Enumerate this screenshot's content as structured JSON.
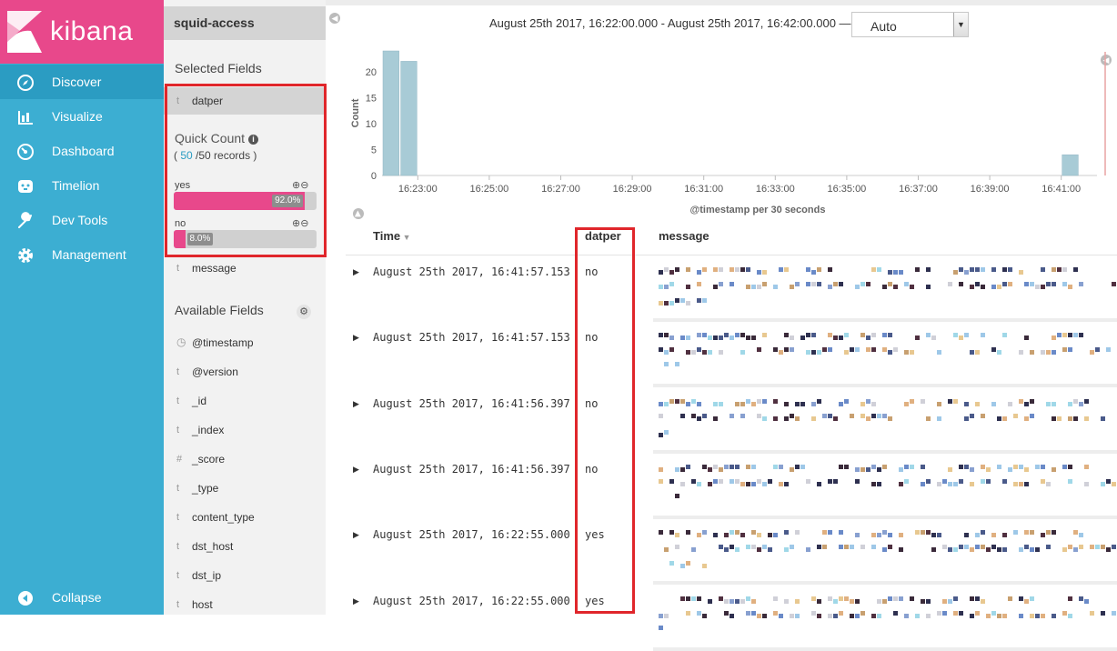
{
  "brand": {
    "name": "kibana",
    "logo_color": "#e8488b",
    "nav_color": "#3caed2"
  },
  "nav": {
    "items": [
      {
        "label": "Discover",
        "icon": "compass-icon",
        "active": true
      },
      {
        "label": "Visualize",
        "icon": "bar-chart-icon",
        "active": false
      },
      {
        "label": "Dashboard",
        "icon": "gauge-icon",
        "active": false
      },
      {
        "label": "Timelion",
        "icon": "timelion-icon",
        "active": false
      },
      {
        "label": "Dev Tools",
        "icon": "wrench-icon",
        "active": false
      },
      {
        "label": "Management",
        "icon": "gear-icon",
        "active": false
      }
    ],
    "collapse_label": "Collapse"
  },
  "sidebar": {
    "index_pattern": "squid-access",
    "selected_title": "Selected Fields",
    "selected_fields": [
      {
        "type": "t",
        "name": "datper"
      },
      {
        "type": "t",
        "name": "message"
      }
    ],
    "quick_count": {
      "title": "Quick Count",
      "records_prefix": "( ",
      "records_link": "50",
      "records_suffix": " /50 records )",
      "values": [
        {
          "label": "yes",
          "percent": 92.0,
          "percent_label": "92.0%"
        },
        {
          "label": "no",
          "percent": 8.0,
          "percent_label": "8.0%"
        }
      ]
    },
    "available_title": "Available Fields",
    "available_fields": [
      {
        "type": "clock",
        "name": "@timestamp"
      },
      {
        "type": "t",
        "name": "@version"
      },
      {
        "type": "t",
        "name": "_id"
      },
      {
        "type": "t",
        "name": "_index"
      },
      {
        "type": "#",
        "name": "_score"
      },
      {
        "type": "t",
        "name": "_type"
      },
      {
        "type": "t",
        "name": "content_type"
      },
      {
        "type": "t",
        "name": "dst_host"
      },
      {
        "type": "t",
        "name": "dst_ip"
      },
      {
        "type": "t",
        "name": "host"
      }
    ]
  },
  "header": {
    "time_range": "August 25th 2017, 16:22:00.000 - August 25th 2017, 16:42:00.000 —",
    "interval": "Auto"
  },
  "chart_data": {
    "type": "bar",
    "ylabel": "Count",
    "xlabel": "@timestamp per 30 seconds",
    "ylim": [
      0,
      24
    ],
    "yticks": [
      0,
      5,
      10,
      15,
      20
    ],
    "xticks": [
      "16:23:00",
      "16:25:00",
      "16:27:00",
      "16:29:00",
      "16:31:00",
      "16:33:00",
      "16:35:00",
      "16:37:00",
      "16:39:00",
      "16:41:00"
    ],
    "bars": [
      {
        "x": "16:22:30",
        "value": 24
      },
      {
        "x": "16:23:00",
        "value": 22
      },
      {
        "x": "16:41:30",
        "value": 4
      }
    ],
    "bar_color": "#a8cbd6",
    "marker_color": "#e8a4a4"
  },
  "table": {
    "columns": [
      "Time",
      "datper",
      "message"
    ],
    "rows": [
      {
        "time": "August 25th 2017, 16:41:57.153",
        "datper": "no"
      },
      {
        "time": "August 25th 2017, 16:41:57.153",
        "datper": "no"
      },
      {
        "time": "August 25th 2017, 16:41:56.397",
        "datper": "no"
      },
      {
        "time": "August 25th 2017, 16:41:56.397",
        "datper": "no"
      },
      {
        "time": "August 25th 2017, 16:22:55.000",
        "datper": "yes"
      },
      {
        "time": "August 25th 2017, 16:22:55.000",
        "datper": "yes"
      }
    ]
  }
}
